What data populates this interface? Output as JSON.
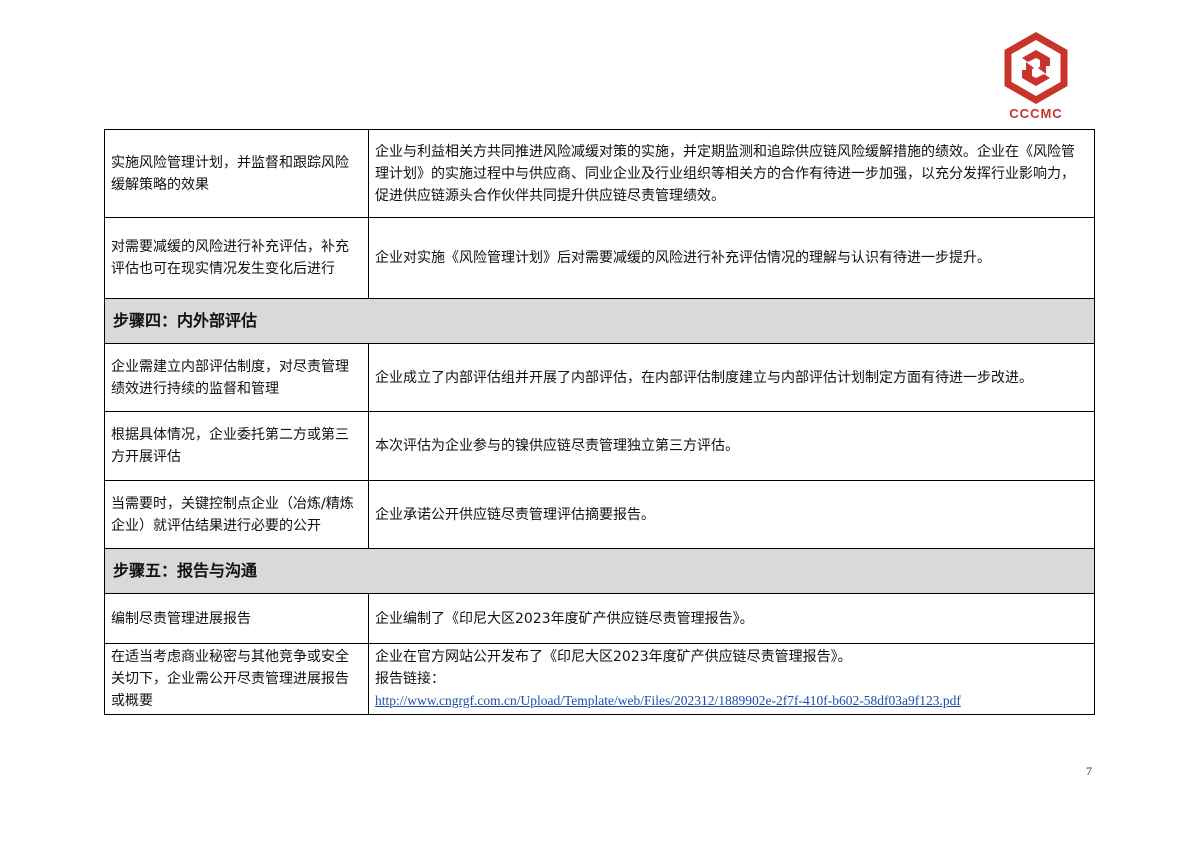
{
  "logo": {
    "text": "CCCMC",
    "color": "#c8332a"
  },
  "rows": [
    {
      "left": "实施风险管理计划，并监督和跟踪风险缓解策略的效果",
      "right": "企业与利益相关方共同推进风险减缓对策的实施，并定期监测和追踪供应链风险缓解措施的绩效。企业在《风险管理计划》的实施过程中与供应商、同业企业及行业组织等相关方的合作有待进一步加强，以充分发挥行业影响力，促进供应链源头合作伙伴共同提升供应链尽责管理绩效。"
    },
    {
      "left": "对需要减缓的风险进行补充评估，补充评估也可在现实情况发生变化后进行",
      "right": "企业对实施《风险管理计划》后对需要减缓的风险进行补充评估情况的理解与认识有待进一步提升。"
    }
  ],
  "section4": {
    "title": "步骤四：内外部评估",
    "rows": [
      {
        "left": "企业需建立内部评估制度，对尽责管理绩效进行持续的监督和管理",
        "right": "企业成立了内部评估组并开展了内部评估，在内部评估制度建立与内部评估计划制定方面有待进一步改进。"
      },
      {
        "left": "根据具体情况，企业委托第二方或第三方开展评估",
        "right": "本次评估为企业参与的镍供应链尽责管理独立第三方评估。"
      },
      {
        "left": "当需要时，关键控制点企业（冶炼/精炼企业）就评估结果进行必要的公开",
        "right": "企业承诺公开供应链尽责管理评估摘要报告。"
      }
    ]
  },
  "section5": {
    "title": "步骤五：报告与沟通",
    "rows": [
      {
        "left": "编制尽责管理进展报告",
        "right": "企业编制了《印尼大区2023年度矿产供应链尽责管理报告》。"
      },
      {
        "left": "在适当考虑商业秘密与其他竞争或安全关切下，企业需公开尽责管理进展报告或概要",
        "right_line1": "企业在官方网站公开发布了《印尼大区2023年度矿产供应链尽责管理报告》。",
        "right_line2": "报告链接：",
        "link": "http://www.cngrgf.com.cn/Upload/Template/web/Files/202312/1889902e-2f7f-410f-b602-58df03a9f123.pdf"
      }
    ]
  },
  "page_number": "7"
}
